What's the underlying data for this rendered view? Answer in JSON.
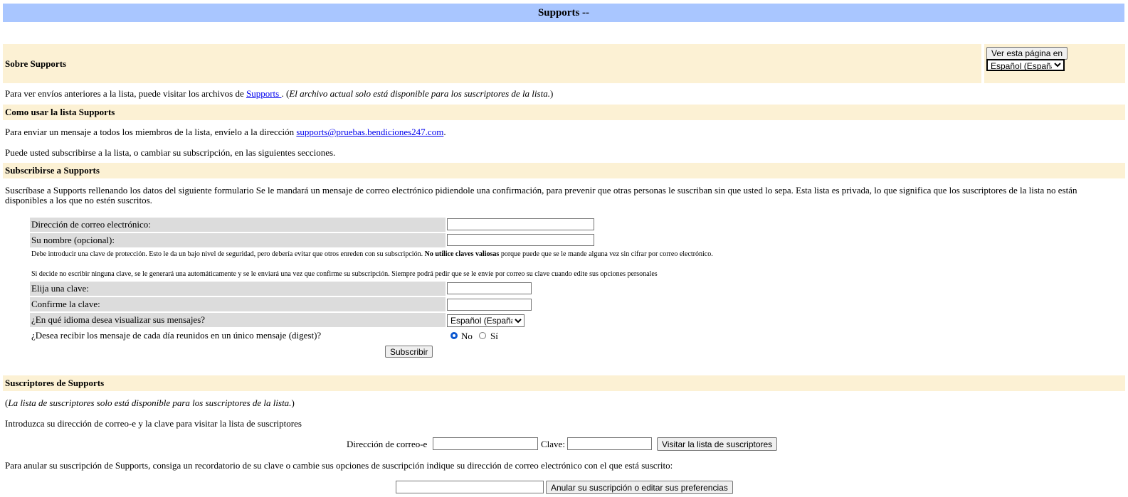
{
  "header": {
    "title": "Supports --"
  },
  "about": {
    "title": "Sobre Supports",
    "lang_button": "Ver esta página en",
    "lang_selected": "Español (España)",
    "archive_prefix": "Para ver envíos anteriores a la lista, puede visitar los archivos de ",
    "archive_link": "Supports ",
    "archive_suffix_note": "El archivo actual solo está disponible para los suscriptores de la lista."
  },
  "usage": {
    "title": "Como usar la lista Supports",
    "send_prefix": "Para enviar un mensaje a todos los miembros de la lista, envíelo a la dirección ",
    "email_link": "supports@pruebas.bendiciones247.com",
    "subscribe_info": "Puede usted subscribirse a la lista, o cambiar su subscripción, en las siguientes secciones."
  },
  "subscribe": {
    "title": "Subscribirse a Supports",
    "intro": "Suscríbase a Supports rellenando los datos del siguiente formulario Se le mandará un mensaje de correo electrónico pidiendole una confirmación, para prevenir que otras personas le suscriban sin que usted lo sepa. Esta lista es privada, lo que significa que los suscriptores de la lista no están disponibles a los que no estén suscritos.",
    "email_label": "Dirección de correo electrónico:",
    "name_label": "Su nombre (opcional):",
    "pw_note_1": "Debe introducir una clave de protección. Esto le da un bajo nivel de seguridad, pero debería evitar que otros enreden con su subscripción. ",
    "pw_note_bold": "No utilice claves valiosas",
    "pw_note_2": " porque puede que se le mande alguna vez sin cifrar por correo electrónico.",
    "pw_note_3": "Si decide no escribir ninguna clave, se le generará una automáticamente y se le enviará una vez que confirme su subscripción. Siempre podrá pedir que se le envíe por correo su clave cuando edite sus opciones personales",
    "pw_label": "Elija una clave:",
    "pw_confirm_label": "Confirme la clave:",
    "lang_label": "¿En qué idioma desea visualizar sus mensajes?",
    "lang_selected": "Español (España)",
    "digest_label": "¿Desea recibir los mensaje de cada día reunidos en un único mensaje (digest)?",
    "digest_no": "No",
    "digest_yes": "Sí",
    "submit": "Subscribir"
  },
  "subscribers": {
    "title": "Suscriptores de Supports",
    "note": "La lista de suscriptores solo está disponible para los suscriptores de la lista.",
    "instructions": "Introduzca su dirección de correo-e y la clave para visitar la lista de suscriptores",
    "email_label": "Dirección de correo-e",
    "pw_label": "Clave:",
    "visit_button": "Visitar la lista de suscriptores",
    "unsubscribe_text": "Para anular su suscripción de Supports, consiga un recordatorio de su clave o cambie sus opciones de suscripción indique su dirección de correo electrónico con el que está suscrito:",
    "unsubscribe_button": "Anular su suscripción o editar sus preferencias"
  }
}
